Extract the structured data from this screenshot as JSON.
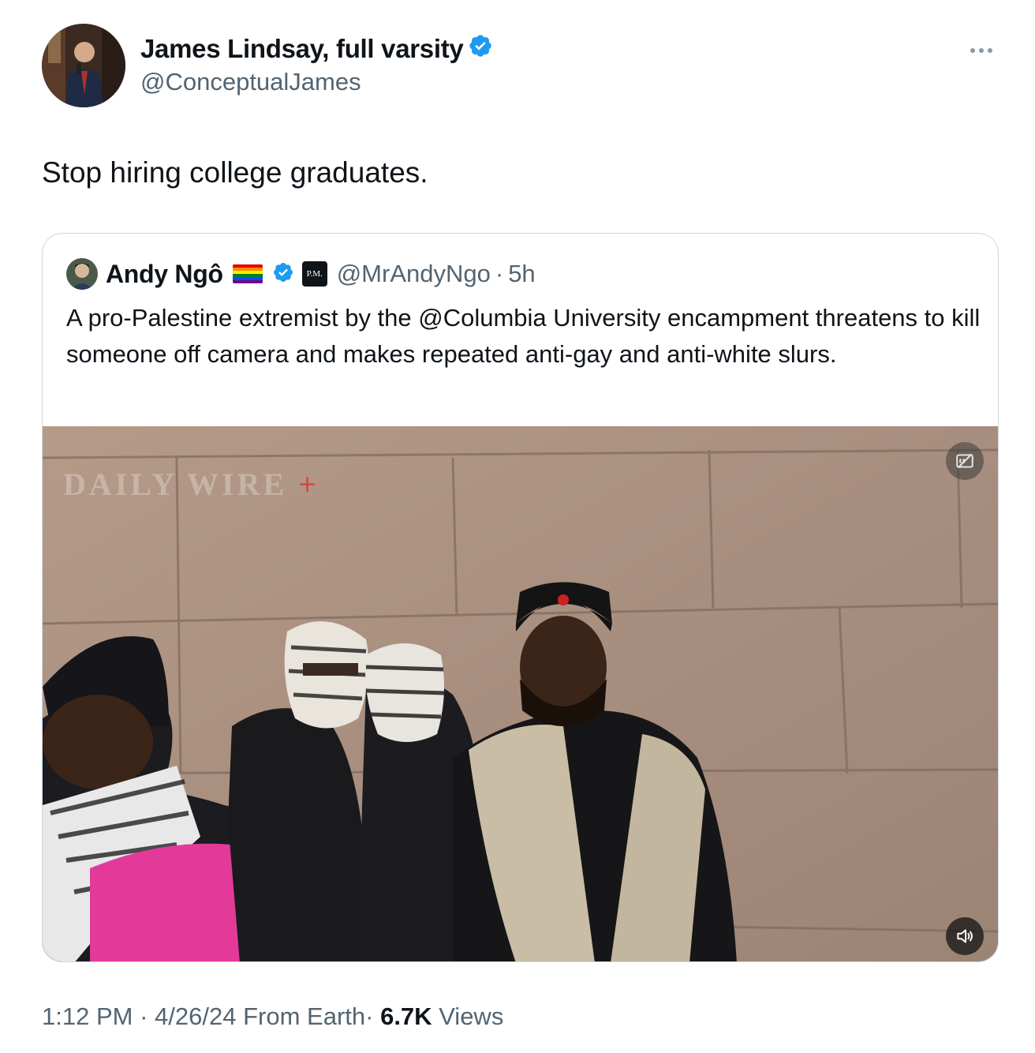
{
  "author": {
    "name": "James Lindsay, full varsity",
    "handle": "@ConceptualJames",
    "avatar_icon": "profile-photo",
    "verified": true
  },
  "tweet": {
    "text": "Stop hiring college graduates."
  },
  "quoted_tweet": {
    "name": "Andy Ngô",
    "flag_emoji": "rainbow-flag",
    "verified": true,
    "affiliation_badge": "P.M.",
    "handle": "@MrAndyNgo",
    "separator": "·",
    "time": "5h",
    "text": "A pro-Palestine extremist by the @Columbia University encampment threatens to kill someone off camera and makes repeated anti-gay and anti-white slurs.",
    "media": {
      "type": "video",
      "watermark": "DAILY WIRE",
      "watermark_mark": "+",
      "controls": [
        "captions-icon",
        "volume-icon"
      ]
    }
  },
  "meta": {
    "time": "1:12 PM",
    "sep1": "·",
    "date": "4/26/24",
    "source": "From Earth",
    "sep2": "·",
    "views_count": "6.7K",
    "views_label": "Views"
  },
  "colors": {
    "verified_blue": "#1d9bf0",
    "secondary_text": "#536471",
    "border": "#cfd9de"
  }
}
